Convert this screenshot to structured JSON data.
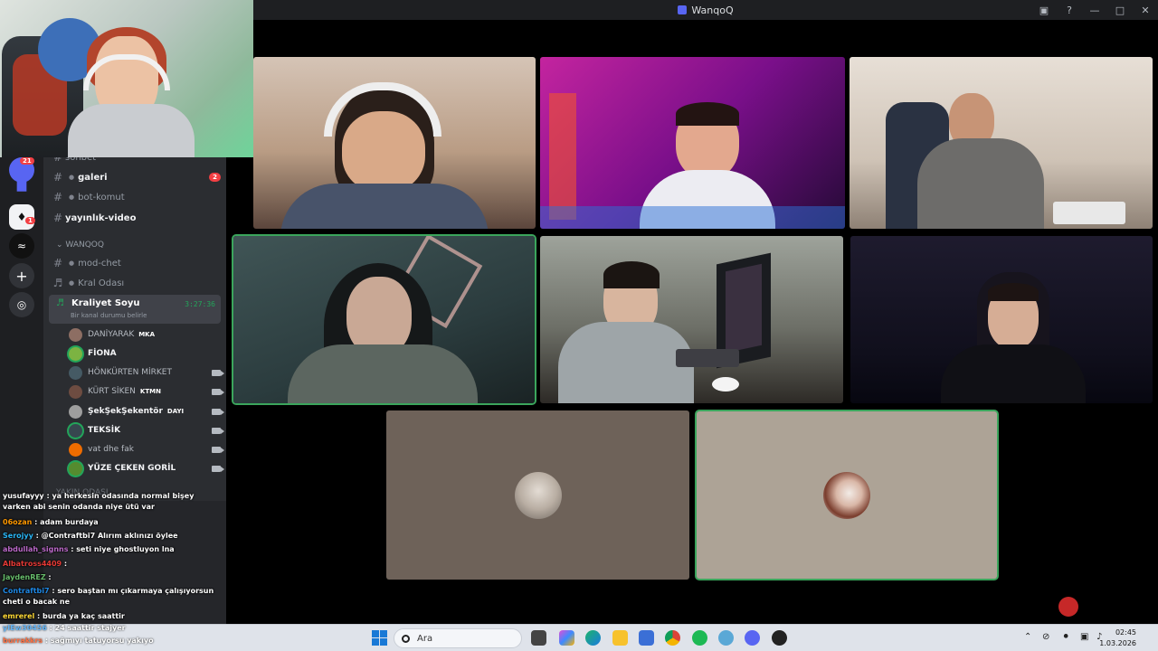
{
  "window": {
    "title": "WanqoQ"
  },
  "channels": {
    "items": [
      {
        "label": "sohbet",
        "kind": "text"
      },
      {
        "label": "galeri",
        "kind": "text",
        "count": "2"
      },
      {
        "label": "bot-komut",
        "kind": "text"
      },
      {
        "label": "yayınlık-video",
        "kind": "text"
      }
    ],
    "category": "WANQOQ",
    "sub_items": [
      {
        "label": "mod-chet",
        "kind": "text"
      },
      {
        "label": "Kral Odası",
        "kind": "voice"
      }
    ],
    "active_voice": {
      "label": "Kraliyet Soyu",
      "time": "3:27:36",
      "status": "Bir kanal durumu belirle"
    },
    "next_category": "YAKIN ODASI"
  },
  "members": [
    {
      "name": "DANİYARAK",
      "tag": "MKA",
      "color": "#8d6e63"
    },
    {
      "name": "FİONA",
      "tag": "",
      "color": "#7cb342"
    },
    {
      "name": "HÖNKÜRTEN MİRKET",
      "tag": "",
      "color": "#455a64"
    },
    {
      "name": "KÜRT SİKEN",
      "tag": "KTMN",
      "color": "#6d4c41"
    },
    {
      "name": "ŞekŞekŞekentör",
      "tag": "DAYI",
      "color": "#9e9e9e"
    },
    {
      "name": "TEKSİK",
      "tag": "",
      "color": "#37474f"
    },
    {
      "name": "vat dhe fak",
      "tag": "",
      "color": "#ef6c00"
    },
    {
      "name": "YÜZE ÇEKEN GORİL",
      "tag": "",
      "color": "#558b2f"
    }
  ],
  "rail": {
    "badges": [
      "21",
      "1"
    ]
  },
  "chat": [
    {
      "user": "yusufayyy",
      "text": "ya herkesin odasında normal bişey varken abi senin odanda niye ütü var",
      "color": "#ffffff"
    },
    {
      "user": "06ozan",
      "text": "adam burdaya",
      "color": "#ff9800"
    },
    {
      "user": "Serojyy",
      "text": "@Contraftbi7 Alırım aklınızı öylee",
      "color": "#29b6f6"
    },
    {
      "user": "abdullah_signns",
      "text": "seti niye ghostluyon lna",
      "color": "#ba68c8"
    },
    {
      "user": "Albatross4409",
      "text": "",
      "color": "#e53935"
    },
    {
      "user": "JaydenREZ",
      "text": "",
      "color": "#66bb6a"
    },
    {
      "user": "Contraftbi7",
      "text": "sero baştan mı çıkarmaya çalışıyorsun cheti o bacak ne",
      "color": "#1e88e5"
    },
    {
      "user": "emrerel",
      "text": "burda ya kaç saattir",
      "color": "#fdd835"
    },
    {
      "user": "yIEw30456",
      "text": "24 saattir stajyer",
      "color": "#64b5f6"
    },
    {
      "user": "burrakkrs",
      "text": "sağmıyı tatuyorsu yakıyo",
      "color": "#ff7043"
    }
  ],
  "taskbar": {
    "search_placeholder": "Ara",
    "time": "02:45",
    "date": "1.03.2026"
  }
}
